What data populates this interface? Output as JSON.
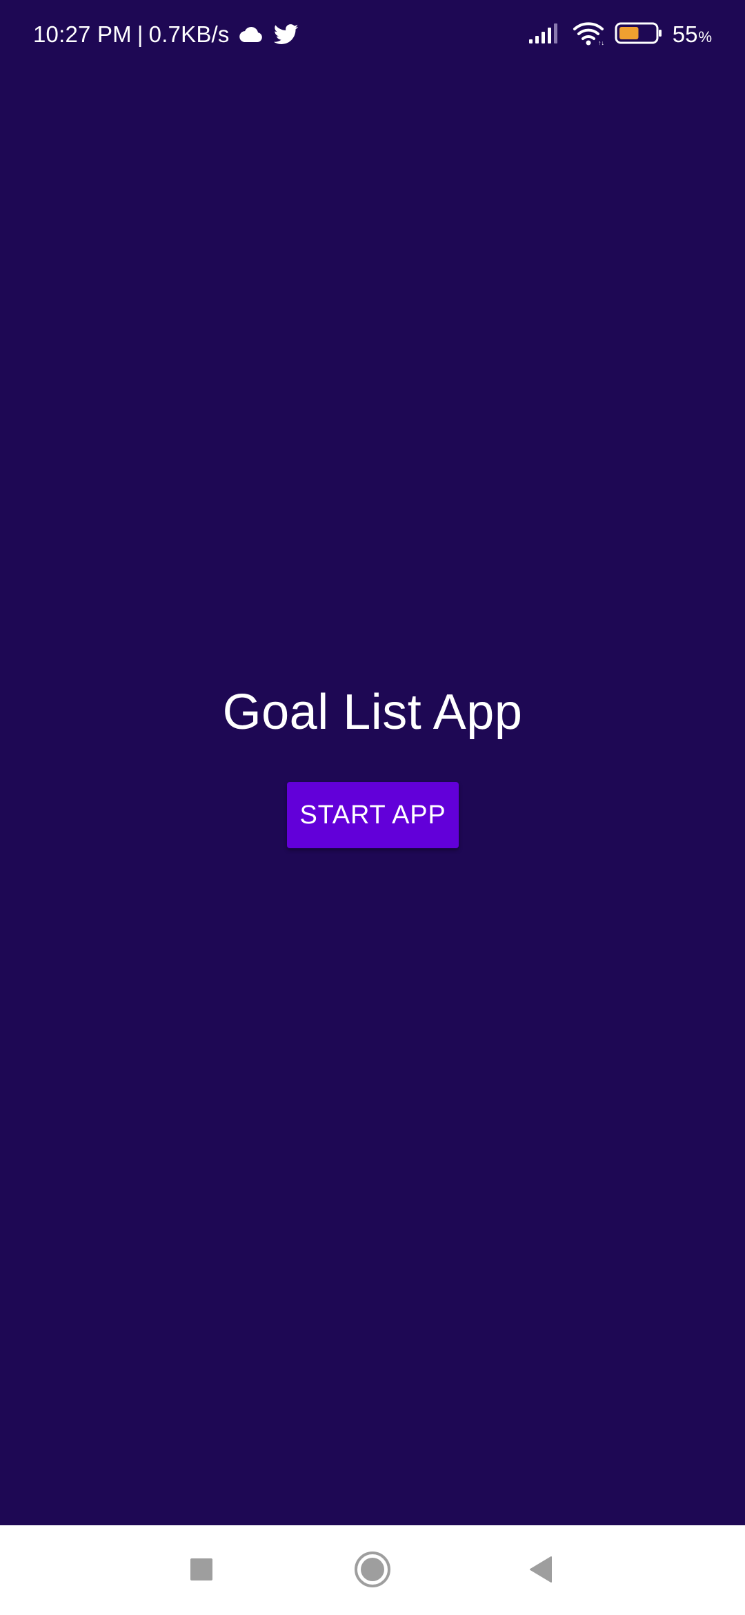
{
  "status_bar": {
    "time": "10:27 PM",
    "separator": "|",
    "network_speed": "0.7KB/s",
    "battery_level": "55",
    "battery_unit": "%",
    "icons": [
      "cloud-icon",
      "twitter-icon",
      "signal-icon",
      "wifi-icon",
      "battery-icon"
    ],
    "battery_fill_fraction": 0.55,
    "battery_fill_color": "#f0a030"
  },
  "main": {
    "title": "Goal List App",
    "start_button_label": "START APP"
  },
  "nav_bar": {
    "buttons": [
      "recents-icon",
      "home-icon",
      "back-icon"
    ]
  },
  "colors": {
    "background": "#1e0854",
    "accent_button": "#6200d9",
    "text": "#ffffff",
    "nav_bar": "#ffffff",
    "nav_icons": "#9e9e9e"
  }
}
